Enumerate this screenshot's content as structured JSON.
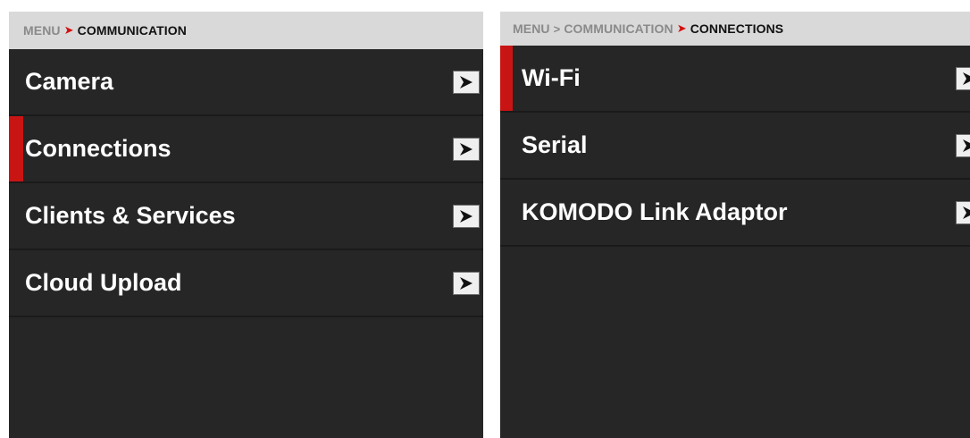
{
  "left_panel": {
    "breadcrumb": {
      "items": [
        "MENU",
        "COMMUNICATION"
      ]
    },
    "items": [
      {
        "label": "Camera",
        "selected": false
      },
      {
        "label": "Connections",
        "selected": true
      },
      {
        "label": "Clients & Services",
        "selected": false
      },
      {
        "label": "Cloud Upload",
        "selected": false
      }
    ]
  },
  "right_panel": {
    "breadcrumb": {
      "items": [
        "MENU",
        "COMMUNICATION",
        "CONNECTIONS"
      ]
    },
    "items": [
      {
        "label": "Wi-Fi",
        "selected": true
      },
      {
        "label": "Serial",
        "selected": false
      },
      {
        "label": "KOMODO Link Adaptor",
        "selected": false
      }
    ]
  },
  "icons": {
    "submenu_arrow": "chevron-right-icon",
    "breadcrumb_separator": "chevron-right-icon"
  },
  "colors": {
    "selection_accent": "#c91414",
    "breadcrumb_separator": "#d40f0f",
    "panel_background": "#262626",
    "header_background": "#d9d9d9"
  }
}
